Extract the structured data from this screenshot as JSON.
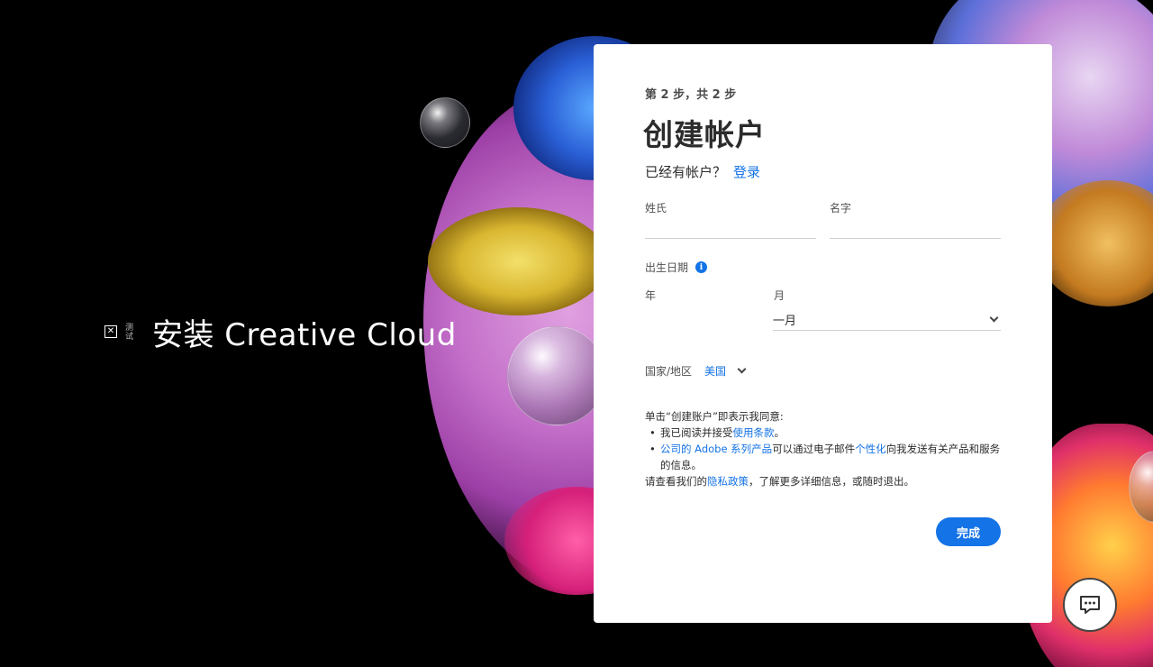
{
  "header": {
    "close_glyph": "✕",
    "vertical_text": "测试",
    "title": "安装 Creative Cloud"
  },
  "form": {
    "step": "第 2 步，共 2 步",
    "title": "创建帐户",
    "has_account_text": "已经有帐户？",
    "signin_link": "登录",
    "last_name_label": "姓氏",
    "first_name_label": "名字",
    "dob_label": "出生日期",
    "year_label": "年",
    "month_label": "月",
    "month_value": "一月",
    "country_label": "国家/地区",
    "country_value": "美国",
    "legal_intro": "单击“创建账户”即表示我同意:",
    "legal_item1_pre": "我已阅读并接受",
    "legal_item1_link": "使用条款",
    "legal_item1_post": "。",
    "legal_item2_link1": "公司的 Adobe 系列产品",
    "legal_item2_mid": "可以通过电子邮件",
    "legal_item2_link2": "个性化",
    "legal_item2_post": "向我发送有关产品和服务的信息。",
    "legal_privacy_pre": "请查看我们的",
    "legal_privacy_link": "隐私政策",
    "legal_privacy_post": "，了解更多详细信息，或随时退出。",
    "done_button": "完成"
  },
  "colors": {
    "accent": "#1473e6",
    "highlight": "#e02424",
    "background": "#000000"
  }
}
